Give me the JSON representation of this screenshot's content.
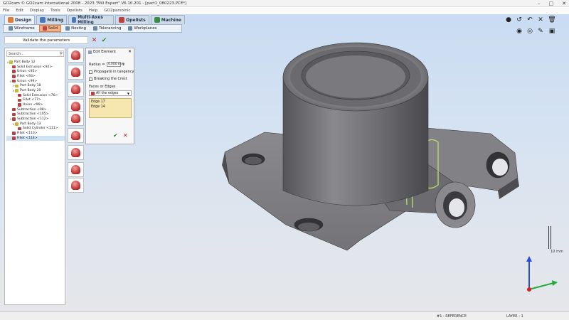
{
  "window": {
    "title": "GO2cam  © GO2cam International 2008 - 2023    \"Mill Expert\"    V6.10.201 - [part1_080223.PCE*]",
    "controls": [
      "minimize-icon",
      "maximize-icon",
      "close-icon"
    ]
  },
  "menu": [
    "File",
    "Edit",
    "Display",
    "Tools",
    "Opelists",
    "Help",
    "GO2parsolnic"
  ],
  "ribbon": {
    "tabs": [
      {
        "label": "Design",
        "icon": "design-icon",
        "active": true
      },
      {
        "label": "Milling",
        "icon": "milling-icon",
        "active": false
      },
      {
        "label": "Multi-Axes Milling",
        "icon": "multiaxis-icon",
        "active": false
      },
      {
        "label": "Opelists",
        "icon": "opelists-icon",
        "active": false
      },
      {
        "label": "Machine",
        "icon": "machine-icon",
        "active": false
      }
    ],
    "subtabs": [
      {
        "label": "Wireframe",
        "active": false
      },
      {
        "label": "Solid",
        "active": true
      },
      {
        "label": "Nesting",
        "active": false
      },
      {
        "label": "Tolerancing",
        "active": false
      },
      {
        "label": "Workplanes",
        "active": false
      }
    ]
  },
  "validate": {
    "label": "Validate the parameters",
    "cancel_icon": "cancel-x-icon",
    "ok_icon": "check-icon"
  },
  "tree": {
    "search_placeholder": "Search...",
    "items": [
      {
        "label": "Part Body 12",
        "indent": 0,
        "expand": "v",
        "color": "#c7b93a"
      },
      {
        "label": "Solid Extrusion <92>",
        "indent": 1,
        "expand": "",
        "color": "#b94040"
      },
      {
        "label": "Union <95>",
        "indent": 1,
        "expand": "",
        "color": "#b94040"
      },
      {
        "label": "Fillet <93>",
        "indent": 1,
        "expand": "",
        "color": "#b94040"
      },
      {
        "label": "Union <99>",
        "indent": 1,
        "expand": "v",
        "color": "#b94040"
      },
      {
        "label": "Part Body 18",
        "indent": 2,
        "expand": ">",
        "color": "#c7b93a"
      },
      {
        "label": "Part Body 20",
        "indent": 2,
        "expand": "v",
        "color": "#c7b93a"
      },
      {
        "label": "Solid Extrusion <76>",
        "indent": 3,
        "expand": "",
        "color": "#b94040"
      },
      {
        "label": "Fillet <77>",
        "indent": 3,
        "expand": "",
        "color": "#b94040"
      },
      {
        "label": "Union <96>",
        "indent": 3,
        "expand": "",
        "color": "#b94040"
      },
      {
        "label": "Subtraction <98>",
        "indent": 1,
        "expand": "",
        "color": "#b94040"
      },
      {
        "label": "Subtraction <105>",
        "indent": 1,
        "expand": "",
        "color": "#b94040"
      },
      {
        "label": "Subtraction <112>",
        "indent": 1,
        "expand": "v",
        "color": "#b94040"
      },
      {
        "label": "Part Body 13",
        "indent": 2,
        "expand": "v",
        "color": "#c7b93a"
      },
      {
        "label": "Solid Cylinder <111>",
        "indent": 3,
        "expand": "",
        "color": "#b94040"
      },
      {
        "label": "Fillet <113>",
        "indent": 1,
        "expand": "",
        "color": "#b94040"
      },
      {
        "label": "Fillet <114>",
        "indent": 1,
        "expand": "",
        "color": "#b94040",
        "selected": true
      }
    ]
  },
  "tool_icons": [
    "fillet-tool-icon",
    "chamfer-tool-icon",
    "shell-tool-icon",
    "draft-tool-icon",
    "split-tool-icon",
    "boolean-tool-icon",
    "cut-tool-icon",
    "pattern-tool-icon",
    "mirror-tool-icon",
    "offset-tool-icon"
  ],
  "dialog": {
    "title": "Edit Element",
    "radius_label": "Radius =",
    "radius_value": "4.000 mm",
    "propagate_label": "Propagate in tangency",
    "breaking_label": "Breaking the Crest",
    "faces_label": "Faces or Edges",
    "filter_value": "All the edges",
    "edges": [
      "Edge 17",
      "Edge 14"
    ],
    "ok_icon": "ok-check-icon",
    "cancel_icon": "cancel-icon"
  },
  "scale": {
    "label": "10 mm"
  },
  "axes": {
    "x": "X",
    "y": "Y",
    "z": "Z"
  },
  "status": {
    "reference": "#1 : REFERENCE",
    "layer": "LAYER : 1"
  },
  "colors": {
    "accent_orange": "#f5b183",
    "ribbon_blue": "#d0dbe8",
    "model_gray": "#6d6d70",
    "selected_edge": "#b5d96b",
    "edge_list_bg": "#f6e6b0"
  }
}
